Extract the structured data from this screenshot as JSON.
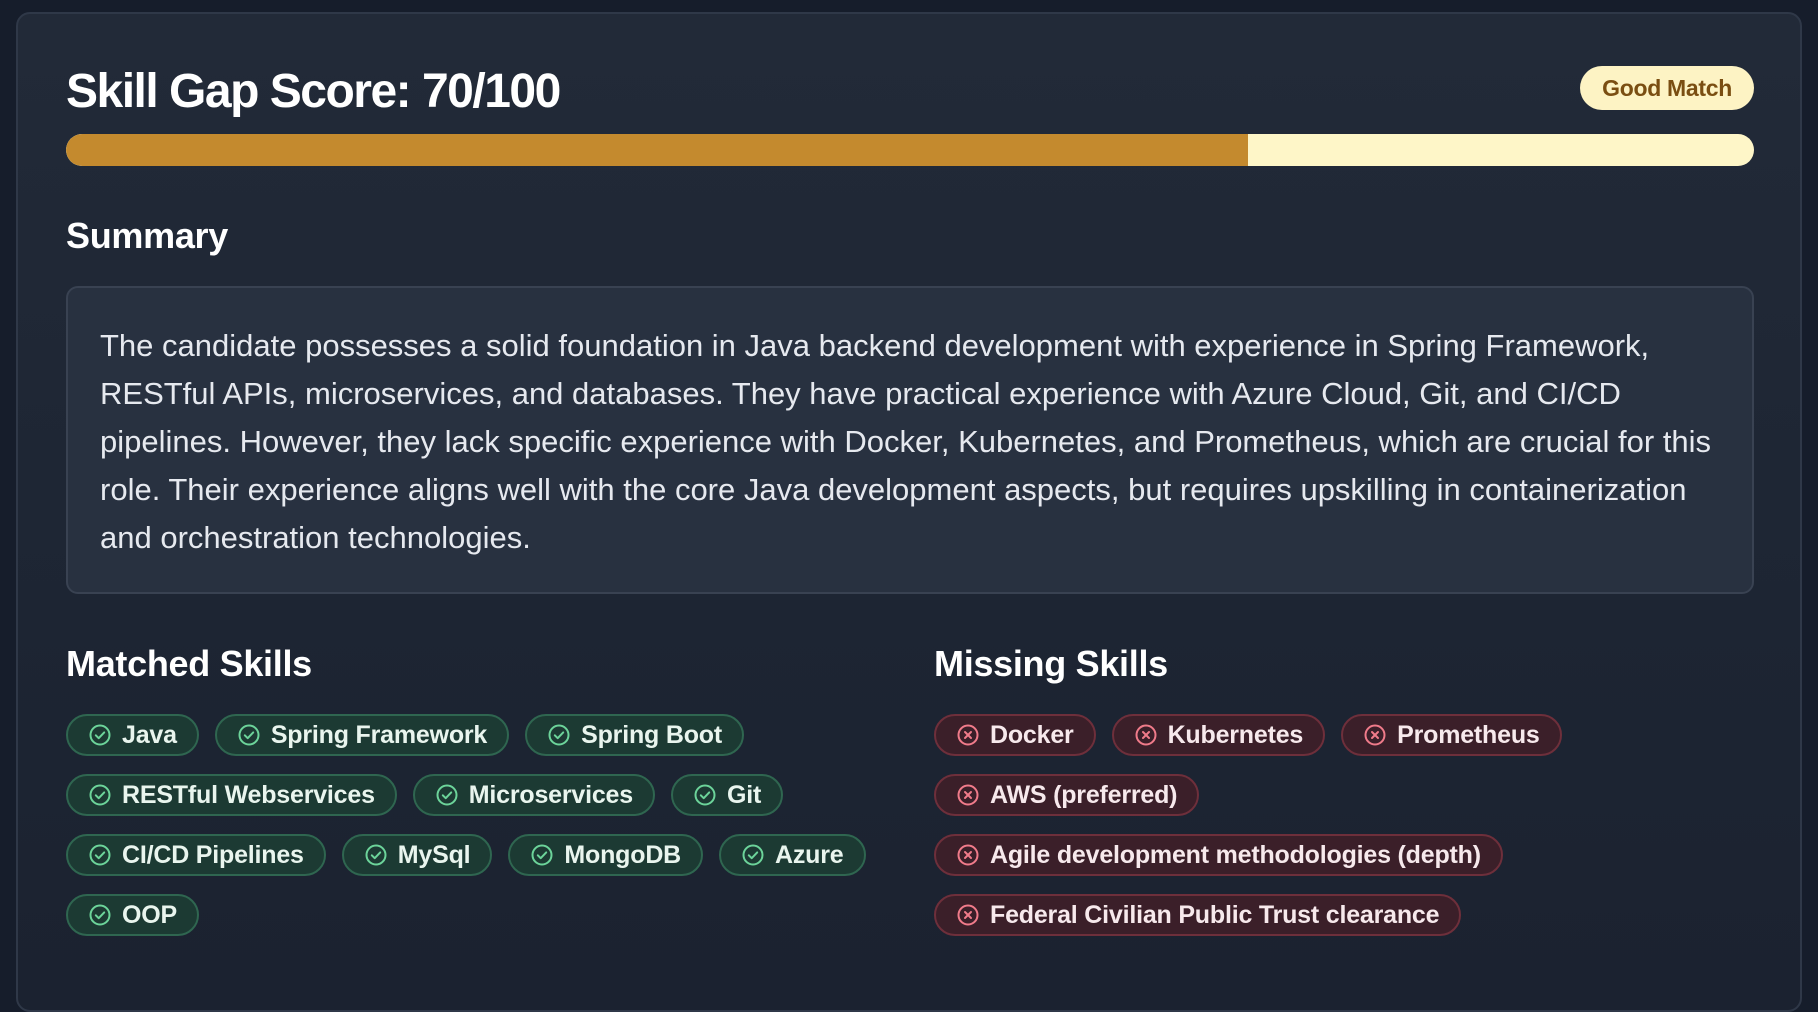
{
  "header": {
    "score_title": "Skill Gap Score: 70/100",
    "match_label": "Good Match",
    "score": 70,
    "score_max": 100
  },
  "summary": {
    "heading": "Summary",
    "text": "The candidate possesses a solid foundation in Java backend development with experience in Spring Framework, RESTful APIs, microservices, and databases. They have practical experience with Azure Cloud, Git, and CI/CD pipelines. However, they lack specific experience with Docker, Kubernetes, and Prometheus, which are crucial for this role. Their experience aligns well with the core Java development aspects, but requires upskilling in containerization and orchestration technologies."
  },
  "matched": {
    "heading": "Matched Skills",
    "icon": "check-circle-icon",
    "items": [
      "Java",
      "Spring Framework",
      "Spring Boot",
      "RESTful Webservices",
      "Microservices",
      "Git",
      "CI/CD Pipelines",
      "MySql",
      "MongoDB",
      "Azure",
      "OOP"
    ]
  },
  "missing": {
    "heading": "Missing Skills",
    "icon": "x-circle-icon",
    "items": [
      "Docker",
      "Kubernetes",
      "Prometheus",
      "AWS (preferred)",
      "Agile development methodologies (depth)",
      "Federal Civilian Public Trust clearance"
    ]
  },
  "colors": {
    "progress_fill": "#c48a2e",
    "progress_track": "#fef6c8",
    "badge_bg": "#fdf3c4",
    "badge_text": "#7a4e12",
    "matched_icon": "#6cd49a",
    "missing_icon": "#f07b8a"
  }
}
